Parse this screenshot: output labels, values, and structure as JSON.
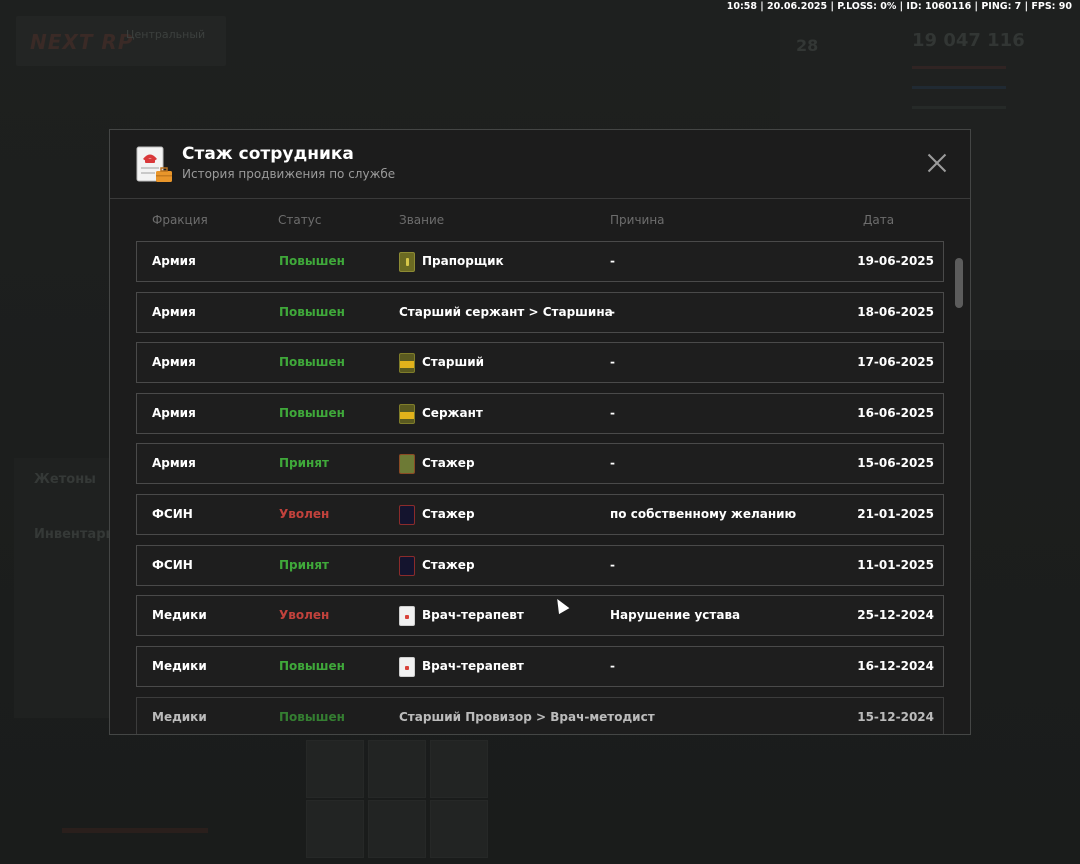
{
  "status_bar": {
    "text": "10:58 | 20.06.2025 | P.LOSS: 0% | ID: 1060116 | PING: 7 | FPS: 90"
  },
  "background": {
    "logo": "NEXT RP",
    "logo_sub": "Центральный",
    "money": "19 047 116",
    "level": "28",
    "side_tab_1": "Жетоны",
    "side_tab_2": "Инвентарь"
  },
  "modal": {
    "title": "Стаж сотрудника",
    "subtitle": "История продвижения по службе",
    "icon": "document-phone-briefcase-icon",
    "columns": {
      "faction": "Фракция",
      "status": "Статус",
      "rank": "Звание",
      "reason": "Причина",
      "date": "Дата"
    },
    "rows": [
      {
        "faction": "Армия",
        "status": "Повышен",
        "status_type": "up",
        "rank_icon": "olive",
        "rank": "Прапорщик",
        "reason": "-",
        "date": "19-06-2025"
      },
      {
        "faction": "Армия",
        "status": "Повышен",
        "status_type": "up",
        "rank_icon": "",
        "rank": "Старший сержант > Старшина",
        "reason": "-",
        "date": "18-06-2025"
      },
      {
        "faction": "Армия",
        "status": "Повышен",
        "status_type": "up",
        "rank_icon": "gold",
        "rank": "Старший",
        "reason": "-",
        "date": "17-06-2025"
      },
      {
        "faction": "Армия",
        "status": "Повышен",
        "status_type": "up",
        "rank_icon": "gold",
        "rank": "Сержант",
        "reason": "-",
        "date": "16-06-2025"
      },
      {
        "faction": "Армия",
        "status": "Принят",
        "status_type": "accepted",
        "rank_icon": "green",
        "rank": "Стажер",
        "reason": "-",
        "date": "15-06-2025"
      },
      {
        "faction": "ФСИН",
        "status": "Уволен",
        "status_type": "fired",
        "rank_icon": "navy",
        "rank": "Стажер",
        "reason": "по собственному желанию",
        "date": "21-01-2025"
      },
      {
        "faction": "ФСИН",
        "status": "Принят",
        "status_type": "accepted",
        "rank_icon": "navy",
        "rank": "Стажер",
        "reason": "-",
        "date": "11-01-2025"
      },
      {
        "faction": "Медики",
        "status": "Уволен",
        "status_type": "fired",
        "rank_icon": "white",
        "rank": "Врач-терапевт",
        "reason": "Нарушение устава",
        "date": "25-12-2024"
      },
      {
        "faction": "Медики",
        "status": "Повышен",
        "status_type": "up",
        "rank_icon": "white",
        "rank": "Врач-терапевт",
        "reason": "-",
        "date": "16-12-2024"
      },
      {
        "faction": "Медики",
        "status": "Повышен",
        "status_type": "up",
        "rank_icon": "",
        "rank": "Старший Провизор > Врач-методист",
        "reason": "",
        "date": "15-12-2024"
      }
    ]
  }
}
